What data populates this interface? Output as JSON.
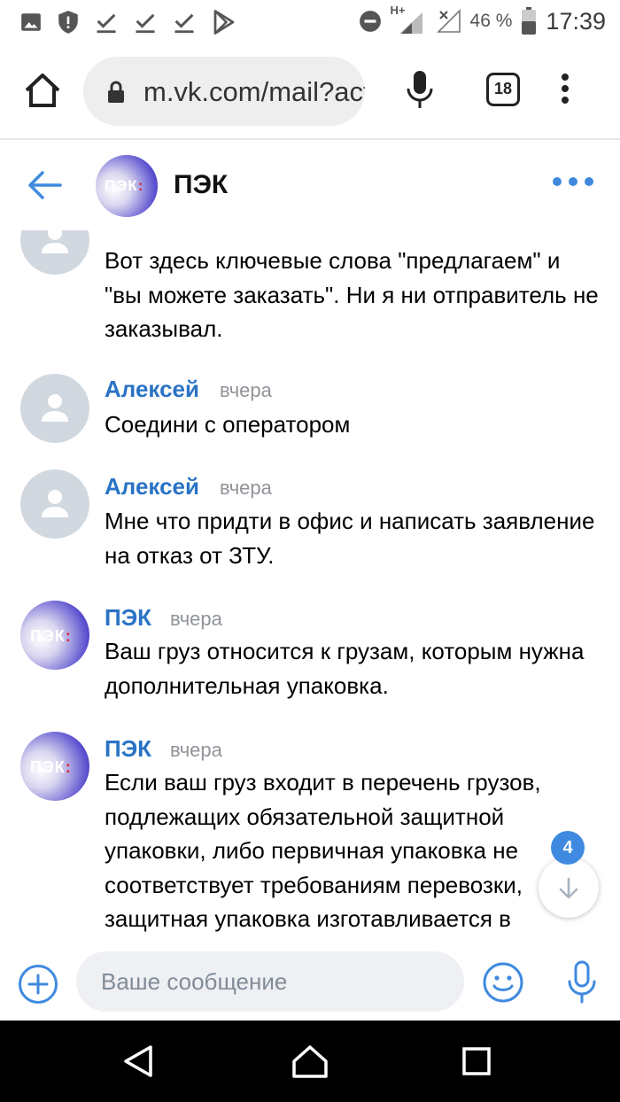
{
  "status_bar": {
    "network_type": "H+",
    "battery_percent": "46 %",
    "time": "17:39",
    "icons": [
      "image-icon",
      "shield-icon",
      "download-done-icon",
      "download-done-icon",
      "download-done-icon",
      "play-store-icon",
      "dnd-icon",
      "signal-icon",
      "no-signal-icon",
      "battery-icon"
    ]
  },
  "browser": {
    "url": "m.vk.com/mail?act=show",
    "tab_count": "18"
  },
  "chat": {
    "title": "ПЭК",
    "avatar_text": "ПЭК",
    "messages": [
      {
        "sender": "",
        "time": "",
        "avatar": "user",
        "text": "Вот здесь ключевые слова \"предлагаем\" и \"вы можете заказать\". Ни я ни отправитель не заказывал."
      },
      {
        "sender": "Алексей",
        "time": "вчера",
        "avatar": "user",
        "text": "Соедини с оператором"
      },
      {
        "sender": "Алексей",
        "time": "вчера",
        "avatar": "user",
        "text": "Мне что придти в офис и написать заявление на отказ от ЗТУ."
      },
      {
        "sender": "ПЭК",
        "time": "вчера",
        "avatar": "pek",
        "text": "Ваш груз относится к грузам, которым нужна дополнительная упаковка."
      },
      {
        "sender": "ПЭК",
        "time": "вчера",
        "avatar": "pek",
        "text": "Если ваш груз входит в перечень грузов, подлежащих обязательной защитной упаковки, либо первичная упаковка не соответствует требованиям перевозки, защитная упаковка изготавливается в"
      }
    ],
    "unread_count": "4"
  },
  "composer": {
    "placeholder": "Ваше сообщение"
  },
  "colors": {
    "accent": "#3f8ae0",
    "name": "#2a73c5",
    "time": "#909499"
  }
}
